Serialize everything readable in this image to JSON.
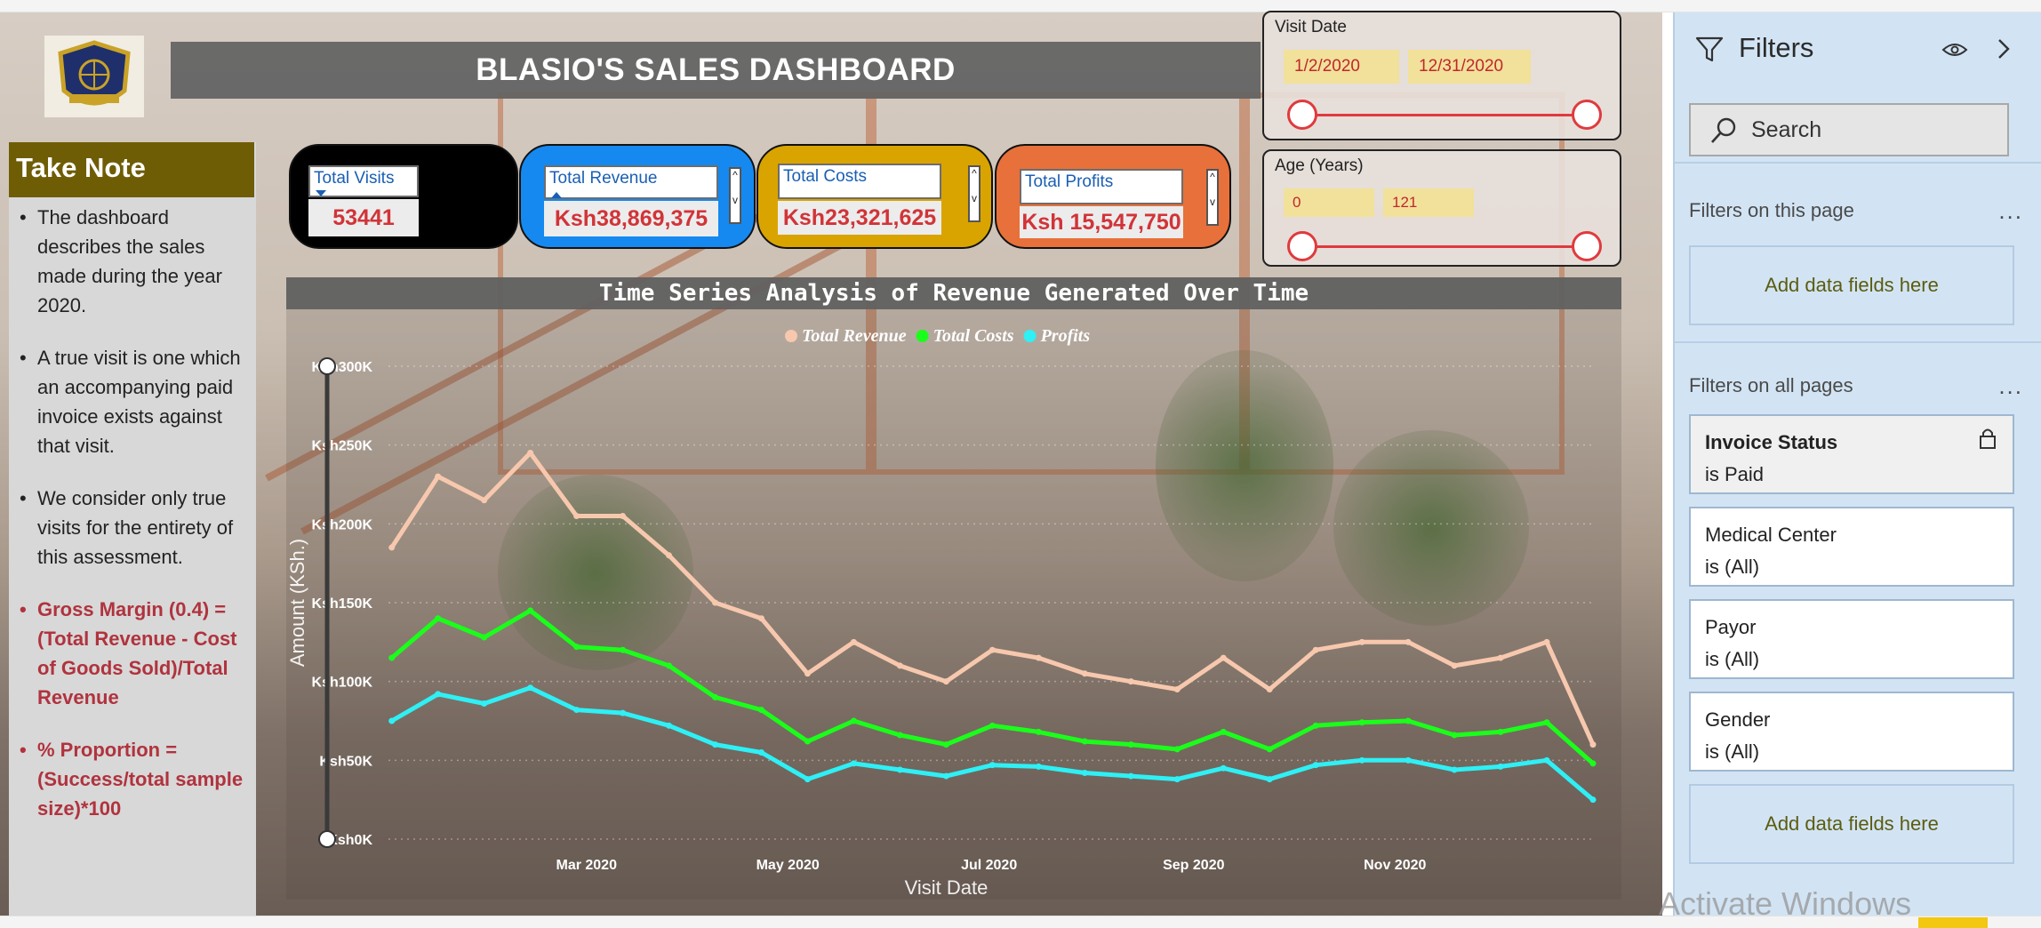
{
  "dashboard": {
    "title": "BLASIO'S SALES DASHBOARD",
    "logo_icon": "university-crest-icon"
  },
  "note": {
    "heading": "Take Note",
    "items": [
      {
        "text": " The dashboard describes the sales made during the year 2020.",
        "highlight": false
      },
      {
        "text": "A true visit is one which an accompanying paid invoice exists against that visit.",
        "highlight": false
      },
      {
        "text": "We consider only true visits for the entirety of this assessment.",
        "highlight": false
      },
      {
        "text": "Gross Margin (0.4) = (Total Revenue - Cost of Goods Sold)/Total Revenue",
        "highlight": true
      },
      {
        "text": "% Proportion = (Success/total sample size)*100",
        "highlight": true
      }
    ]
  },
  "kpis": {
    "visits": {
      "label": "Total Visits",
      "value": "53441",
      "color": "#000000"
    },
    "revenue": {
      "label": "Total Revenue",
      "value": "Ksh38,869,375",
      "color": "#1589f0"
    },
    "costs": {
      "label": "Total Costs",
      "value": "Ksh23,321,625",
      "color": "#d9a400"
    },
    "profits": {
      "label": "Total Profits",
      "value": "Ksh 15,547,750",
      "color": "#e8703a"
    }
  },
  "slicers": {
    "visit_date": {
      "title": "Visit Date",
      "start": "1/2/2020",
      "end": "12/31/2020"
    },
    "age": {
      "title": "Age (Years)",
      "min": "0",
      "max": "121"
    }
  },
  "filters_pane": {
    "title": "Filters",
    "search_placeholder": "Search",
    "this_page_label": "Filters on this page",
    "all_pages_label": "Filters on all pages",
    "add_fields": "Add data fields here",
    "more": "...",
    "cards": [
      {
        "name": "Invoice Status",
        "value": "is Paid",
        "locked": true
      },
      {
        "name": "Medical Center",
        "value": "is (All)",
        "locked": false
      },
      {
        "name": "Payor",
        "value": "is (All)",
        "locked": false
      },
      {
        "name": "Gender",
        "value": "is (All)",
        "locked": false
      }
    ]
  },
  "watermark": "Activate Windows",
  "chart_data": {
    "type": "line",
    "title": "Time Series Analysis of Revenue Generated Over Time",
    "xlabel": "Visit Date",
    "ylabel": "Amount (KSh.)",
    "ylim": [
      0,
      300000
    ],
    "yticks": [
      "Ksh0K",
      "Ksh50K",
      "Ksh100K",
      "Ksh150K",
      "Ksh200K",
      "Ksh250K",
      "Ksh300K"
    ],
    "xticks": [
      {
        "label": "Mar 2020",
        "date": "2020-03-01"
      },
      {
        "label": "May 2020",
        "date": "2020-05-01"
      },
      {
        "label": "Jul 2020",
        "date": "2020-07-01"
      },
      {
        "label": "Sep 2020",
        "date": "2020-09-01"
      },
      {
        "label": "Nov 2020",
        "date": "2020-11-01"
      }
    ],
    "x_range": [
      "2020-01-01",
      "2020-12-31"
    ],
    "x": [
      "2020-01-02",
      "2020-01-16",
      "2020-01-30",
      "2020-02-13",
      "2020-02-27",
      "2020-03-12",
      "2020-03-26",
      "2020-04-09",
      "2020-04-23",
      "2020-05-07",
      "2020-05-21",
      "2020-06-04",
      "2020-06-18",
      "2020-07-02",
      "2020-07-16",
      "2020-07-30",
      "2020-08-13",
      "2020-08-27",
      "2020-09-10",
      "2020-09-24",
      "2020-10-08",
      "2020-10-22",
      "2020-11-05",
      "2020-11-19",
      "2020-12-03",
      "2020-12-17",
      "2020-12-31"
    ],
    "legend_position": "top-center",
    "series": [
      {
        "name": "Total Revenue",
        "color": "#f7c8ae",
        "values": [
          185000,
          230000,
          215000,
          245000,
          205000,
          205000,
          180000,
          150000,
          140000,
          105000,
          125000,
          110000,
          100000,
          120000,
          115000,
          105000,
          100000,
          95000,
          115000,
          95000,
          120000,
          125000,
          125000,
          110000,
          115000,
          125000,
          60000
        ]
      },
      {
        "name": "Total Costs",
        "color": "#1aff1a",
        "values": [
          115000,
          140000,
          128000,
          145000,
          122000,
          120000,
          110000,
          90000,
          82000,
          62000,
          75000,
          66000,
          60000,
          72000,
          68000,
          62000,
          60000,
          57000,
          68000,
          57000,
          72000,
          74000,
          75000,
          66000,
          68000,
          74000,
          48000
        ]
      },
      {
        "name": "Profits",
        "color": "#2ef0f5",
        "values": [
          75000,
          92000,
          86000,
          96000,
          82000,
          80000,
          72000,
          60000,
          55000,
          38000,
          48000,
          44000,
          40000,
          47000,
          46000,
          42000,
          40000,
          38000,
          45000,
          38000,
          47000,
          50000,
          50000,
          44000,
          46000,
          50000,
          25000
        ]
      }
    ]
  }
}
